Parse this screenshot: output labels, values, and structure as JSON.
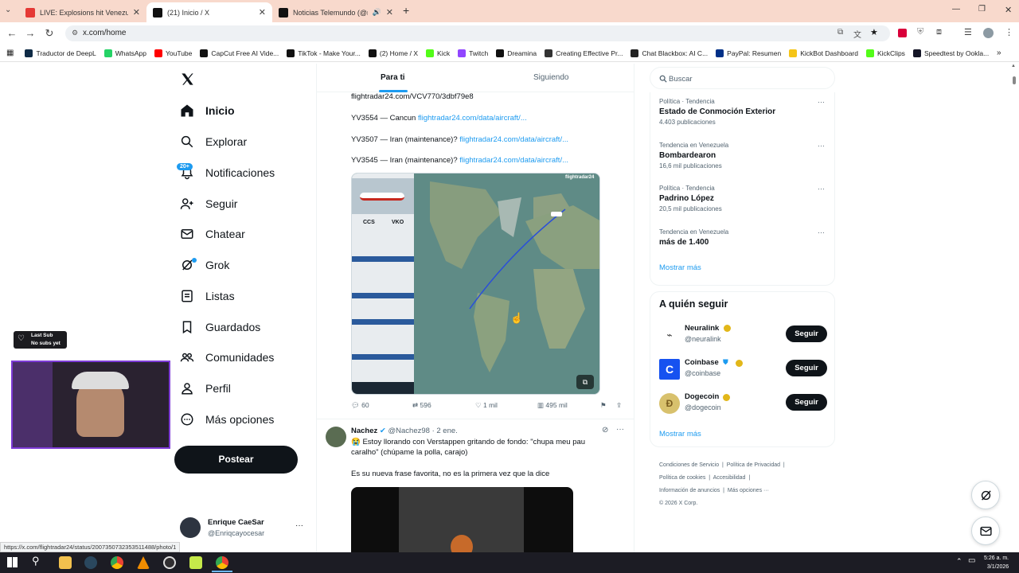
{
  "tabs": [
    {
      "label": "LIVE: Explosions hit Venezuela's",
      "color": "#e53935"
    },
    {
      "label": "(21) Inicio / X",
      "color": "#111"
    },
    {
      "label": "Noticias Telemundo (@noti",
      "color": "#111"
    }
  ],
  "address": {
    "url": "x.com/home"
  },
  "bookmarks": [
    {
      "label": "Traductor de DeepL",
      "color": "#0f2b46"
    },
    {
      "label": "WhatsApp",
      "color": "#25d366"
    },
    {
      "label": "YouTube",
      "color": "#ff0000"
    },
    {
      "label": "CapCut Free AI Vide...",
      "color": "#111"
    },
    {
      "label": "TikTok - Make Your...",
      "color": "#111"
    },
    {
      "label": "(2) Home / X",
      "color": "#111"
    },
    {
      "label": "Kick",
      "color": "#53fc18"
    },
    {
      "label": "Twitch",
      "color": "#9146ff"
    },
    {
      "label": "Dreamina",
      "color": "#111"
    },
    {
      "label": "Creating Effective Pr...",
      "color": "#333"
    },
    {
      "label": "Chat Blackbox: AI C...",
      "color": "#222"
    },
    {
      "label": "PayPal: Resumen",
      "color": "#003087"
    },
    {
      "label": "KickBot Dashboard",
      "color": "#f5c518"
    },
    {
      "label": "KickClips",
      "color": "#53fc18"
    },
    {
      "label": "Speedtest by Ookla...",
      "color": "#141526"
    }
  ],
  "nav": {
    "items": [
      "Inicio",
      "Explorar",
      "Notificaciones",
      "Seguir",
      "Chatear",
      "Grok",
      "Listas",
      "Guardados",
      "Comunidades",
      "Perfil",
      "Más opciones"
    ],
    "notif_badge": "20+",
    "post": "Postear"
  },
  "account": {
    "name": "Enrique CaeSar",
    "handle": "@Enriqcayocesar"
  },
  "overlay": {
    "line1": "Last Sub",
    "line2": "No subs yet"
  },
  "feed": {
    "tabs": [
      "Para ti",
      "Siguiendo"
    ],
    "tweet1": {
      "line0": "flightradar24.com/VCV770/3dbf79e8",
      "lines": [
        {
          "text": "YV3554 — Cancun",
          "link": "flightradar24.com/data/aircraft/..."
        },
        {
          "text": "YV3507 — Iran (maintenance)?",
          "link": "flightradar24.com/data/aircraft/..."
        },
        {
          "text": "YV3545 — Iran (maintenance)?",
          "link": "flightradar24.com/data/aircraft/..."
        }
      ],
      "map": {
        "brand": "flightradar24",
        "from": "CCS",
        "to": "VKO",
        "tag": "VKO"
      },
      "stats": {
        "replies": "60",
        "reposts": "596",
        "likes": "1 mil",
        "views": "495 mil"
      }
    },
    "tweet2": {
      "name": "Nachez",
      "handle": "@Nachez98",
      "date": "· 2 ene.",
      "line1": "😭 Estoy llorando con Verstappen gritando de fondo: \"chupa meu pau",
      "line2": "caralho\" (chúpame la polla, carajo)",
      "line3": "Es su nueva frase favorita, no es la primera vez que la dice"
    }
  },
  "right": {
    "search_placeholder": "Buscar",
    "trends": [
      {
        "meta": "Política · Tendencia",
        "name": "Estado de Conmoción Exterior",
        "count": "4.403 publicaciones"
      },
      {
        "meta": "Tendencia en Venezuela",
        "name": "Bombardearon",
        "count": "16,6 mil publicaciones"
      },
      {
        "meta": "Política · Tendencia",
        "name": "Padrino López",
        "count": "20,5 mil publicaciones"
      },
      {
        "meta": "Tendencia en Venezuela",
        "name": "más de 1.400",
        "count": ""
      }
    ],
    "show_more": "Mostrar más",
    "who_title": "A quién seguir",
    "who": [
      {
        "name": "Neuralink",
        "handle": "@neuralink",
        "btn": "Seguir"
      },
      {
        "name": "Coinbase",
        "handle": "@coinbase",
        "btn": "Seguir"
      },
      {
        "name": "Dogecoin",
        "handle": "@dogecoin",
        "btn": "Seguir"
      }
    ],
    "show_more2": "Mostrar más",
    "footer": {
      "l1a": "Condiciones de Servicio",
      "l1b": "Política de Privacidad",
      "l2a": "Política de cookies",
      "l2b": "Accesibilidad",
      "l3a": "Información de anuncios",
      "l3b": "Más opciones ···",
      "l4": "© 2026 X Corp."
    }
  },
  "status_url": "https://x.com/flightradar24/status/2007350732353511488/photo/1",
  "clock": {
    "time": "5:26 a. m.",
    "date": "3/1/2026"
  }
}
